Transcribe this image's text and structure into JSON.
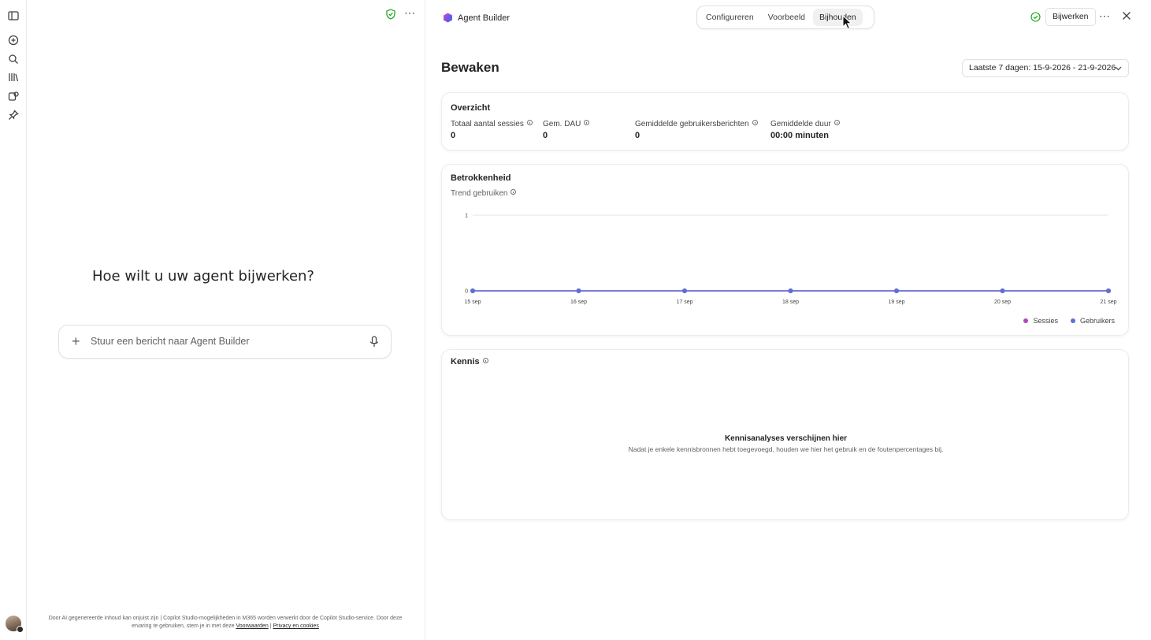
{
  "rail": {
    "items": [
      {
        "name": "sidebar-toggle",
        "icon": "panel-icon"
      },
      {
        "name": "new-chat",
        "icon": "plus-circle-icon"
      },
      {
        "name": "search",
        "icon": "search-icon"
      },
      {
        "name": "library",
        "icon": "library-icon"
      },
      {
        "name": "agents",
        "icon": "agents-icon"
      },
      {
        "name": "pinned",
        "icon": "pin-icon"
      }
    ]
  },
  "chat": {
    "heading": "Hoe wilt u uw agent bijwerken?",
    "input_placeholder": "Stuur een bericht naar Agent Builder",
    "disclaimer_text": "Door AI gegenereerde inhoud kan onjuist zijn | Copilot Studio-mogelijkheden in M365 worden verwerkt door de Copilot Studio-service. Door deze ervaring te gebruiken, stem je in met deze",
    "terms_link": "Voorwaarden",
    "separator": "|",
    "privacy_link": "Privacy en cookies"
  },
  "header": {
    "app_name": "Agent Builder",
    "tabs": [
      {
        "label": "Configureren",
        "active": false
      },
      {
        "label": "Voorbeeld",
        "active": false
      },
      {
        "label": "Bijhouden",
        "active": true
      }
    ],
    "update_button": "Bijwerken"
  },
  "page": {
    "title": "Bewaken",
    "date_range": "Laatste 7 dagen: 15-9-2026 - 21-9-2026"
  },
  "overview": {
    "title": "Overzicht",
    "metrics": [
      {
        "label": "Totaal aantal sessies",
        "value": "0"
      },
      {
        "label": "Gem. DAU",
        "value": "0"
      },
      {
        "label": "Gemiddelde gebruikersberichten",
        "value": "0"
      },
      {
        "label": "Gemiddelde duur",
        "value": "00:00 minuten"
      }
    ]
  },
  "engagement": {
    "title": "Betrokkenheid",
    "subtitle": "Trend gebruiken"
  },
  "chart_data": {
    "type": "line",
    "x": [
      "15 sep",
      "16 sep",
      "17 sep",
      "18 sep",
      "19 sep",
      "20 sep",
      "21 sep"
    ],
    "y_ticks": [
      0,
      1
    ],
    "ylim": [
      0,
      1
    ],
    "grid": true,
    "legend_position": "bottom-right",
    "series": [
      {
        "name": "Sessies",
        "color": "#b146c2",
        "values": [
          0,
          0,
          0,
          0,
          0,
          0,
          0
        ]
      },
      {
        "name": "Gebruikers",
        "color": "#5b6fd6",
        "values": [
          0,
          0,
          0,
          0,
          0,
          0,
          0
        ]
      }
    ]
  },
  "knowledge": {
    "title": "Kennis",
    "empty_title": "Kennisanalyses verschijnen hier",
    "empty_desc": "Nadat je enkele kennisbronnen hebt toegevoegd, houden we hier het gebruik en de foutenpercentages bij."
  },
  "colors": {
    "accent_green": "#13a10e",
    "line_blue": "#5b6fd6"
  }
}
